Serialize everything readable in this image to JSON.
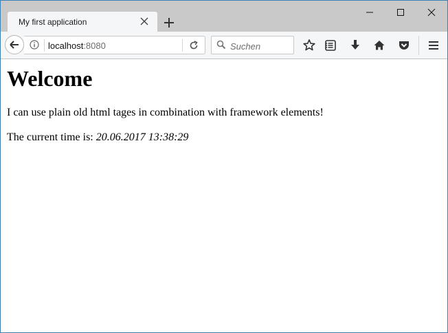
{
  "browser": {
    "tab": {
      "title": "My first application"
    },
    "url": {
      "host": "localhost",
      "port": ":8080"
    },
    "search": {
      "placeholder": "Suchen"
    },
    "toolbar_icons": [
      "bookmark-star-icon",
      "reader-list-icon",
      "download-icon",
      "home-icon",
      "pocket-icon",
      "menu-icon"
    ],
    "window_controls": [
      "minimize",
      "maximize",
      "close"
    ]
  },
  "page": {
    "heading": "Welcome",
    "paragraph": "I can use plain old html tages in combination with framework elements!",
    "time_label": "The current time is: ",
    "time_value": "20.06.2017 13:38:29"
  },
  "colors": {
    "tabstrip": "#c9c9c9",
    "toolbar": "#f5f6f7",
    "window_border": "#3c7fb1"
  }
}
